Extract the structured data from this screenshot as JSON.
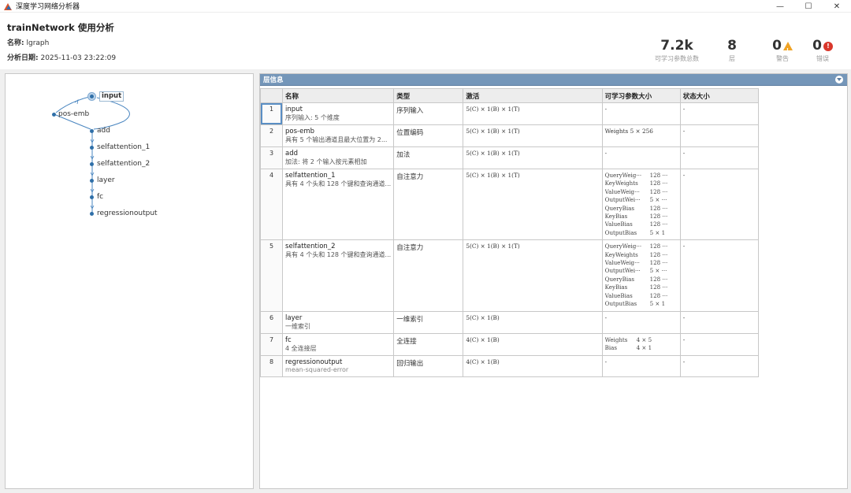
{
  "window": {
    "title": "深度学习网络分析器",
    "controls": [
      "—",
      "☐",
      "✕"
    ]
  },
  "summary": {
    "network_title": "trainNetwork 使用分析",
    "name_label": "名称:",
    "name_value": "lgraph",
    "date_label": "分析日期:",
    "date_value": "2025-11-03 23:22:09",
    "stats": {
      "learnables": {
        "value": "7.2k",
        "label": "可学习参数总数"
      },
      "layers": {
        "value": "8",
        "label": "层"
      },
      "warnings": {
        "value": "0",
        "label": "警告"
      },
      "errors": {
        "value": "0",
        "label": "错误"
      }
    }
  },
  "graph": {
    "nodes": [
      "input",
      "pos-emb",
      "add",
      "selfattention_1",
      "selfattention_2",
      "layer",
      "fc",
      "regressionoutput"
    ]
  },
  "layer_panel": {
    "title": "层信息",
    "columns": [
      "名称",
      "类型",
      "激活",
      "可学习参数大小",
      "状态大小"
    ],
    "rows": [
      {
        "index": "1",
        "name": "input",
        "desc": "序列输入: 5 个维度",
        "type": "序列输入",
        "activation": "5(C) × 1(B) × 1(T)",
        "learnables": [
          "-"
        ],
        "state": "-"
      },
      {
        "index": "2",
        "name": "pos-emb",
        "desc": "具有 5 个输出通道且最大位置为 2...",
        "type": "位置编码",
        "activation": "5(C) × 1(B) × 1(T)",
        "learnables": [
          "Weights  5 × 256"
        ],
        "state": "-"
      },
      {
        "index": "3",
        "name": "add",
        "desc": "加法: 将 2 个输入按元素相加",
        "type": "加法",
        "activation": "5(C) × 1(B) × 1(T)",
        "learnables": [
          "-"
        ],
        "state": "-"
      },
      {
        "index": "4",
        "name": "selfattention_1",
        "desc": "具有 4 个头和 128 个键和查询通道...",
        "type": "自注意力",
        "activation": "5(C) × 1(B) × 1(T)",
        "params": [
          {
            "n": "QueryWeig···",
            "v": "128 ···"
          },
          {
            "n": "KeyWeights",
            "v": "128 ···"
          },
          {
            "n": "ValueWeig···",
            "v": "128 ···"
          },
          {
            "n": "OutputWei···",
            "v": "5 × ···"
          },
          {
            "n": "QueryBias",
            "v": "128 ···"
          },
          {
            "n": "KeyBias",
            "v": "128 ···"
          },
          {
            "n": "ValueBias",
            "v": "128 ···"
          },
          {
            "n": "OutputBias",
            "v": "5 × 1"
          }
        ],
        "state": "-"
      },
      {
        "index": "5",
        "name": "selfattention_2",
        "desc": "具有 4 个头和 128 个键和查询通道...",
        "type": "自注意力",
        "activation": "5(C) × 1(B) × 1(T)",
        "params": [
          {
            "n": "QueryWeig···",
            "v": "128 ···"
          },
          {
            "n": "KeyWeights",
            "v": "128 ···"
          },
          {
            "n": "ValueWeig···",
            "v": "128 ···"
          },
          {
            "n": "OutputWei···",
            "v": "5 × ···"
          },
          {
            "n": "QueryBias",
            "v": "128 ···"
          },
          {
            "n": "KeyBias",
            "v": "128 ···"
          },
          {
            "n": "ValueBias",
            "v": "128 ···"
          },
          {
            "n": "OutputBias",
            "v": "5 × 1"
          }
        ],
        "state": "-"
      },
      {
        "index": "6",
        "name": "layer",
        "desc": "一维索引",
        "type": "一维索引",
        "activation": "5(C) × 1(B)",
        "learnables": [
          "-"
        ],
        "state": "-"
      },
      {
        "index": "7",
        "name": "fc",
        "desc": "4 全连接层",
        "type": "全连接",
        "activation": "4(C) × 1(B)",
        "params": [
          {
            "n": "Weights",
            "v": "4 × 5"
          },
          {
            "n": "Bias",
            "v": "4 × 1"
          }
        ],
        "state": "-"
      },
      {
        "index": "8",
        "name": "regressionoutput",
        "desc": "mean-squared-error",
        "type": "回归输出",
        "activation": "4(C) × 1(B)",
        "learnables": [
          "-"
        ],
        "state": "-"
      }
    ]
  },
  "colors": {
    "accent": "#7496b9",
    "node": "#2f6fa8",
    "warning": "#f0a325",
    "error": "#d9372b"
  }
}
